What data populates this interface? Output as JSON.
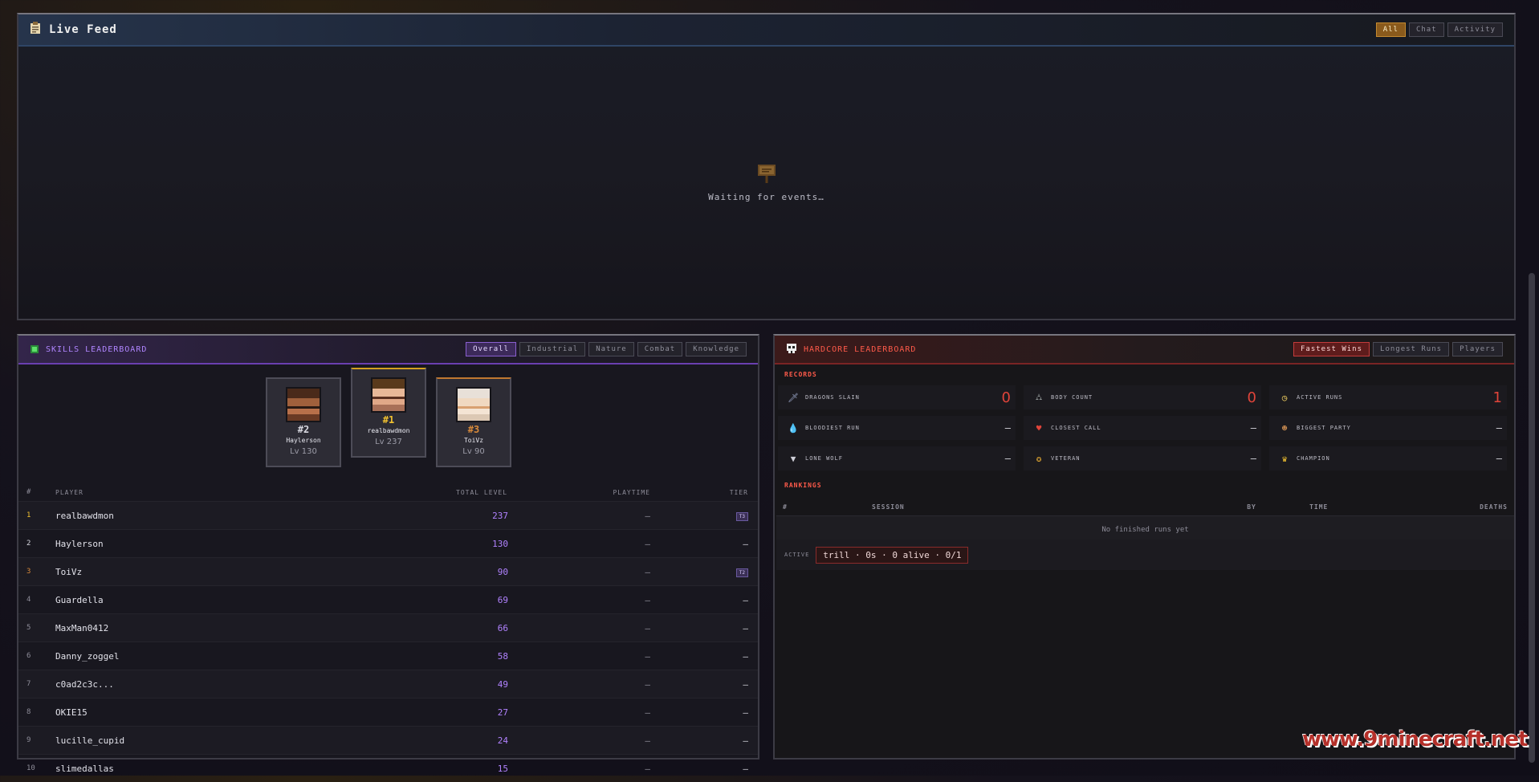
{
  "live_feed": {
    "title": "Live Feed",
    "tabs": [
      "All",
      "Chat",
      "Activity"
    ],
    "active_tab": "All",
    "empty_message": "Waiting for events…"
  },
  "skills": {
    "title": "SKILLS LEADERBOARD",
    "tabs": [
      "Overall",
      "Industrial",
      "Nature",
      "Combat",
      "Knowledge"
    ],
    "active_tab": "Overall",
    "podium": [
      {
        "rank": "#2",
        "name": "Haylerson",
        "level": "Lv 130"
      },
      {
        "rank": "#1",
        "name": "realbawdmon",
        "level": "Lv 237"
      },
      {
        "rank": "#3",
        "name": "ToiVz",
        "level": "Lv 90"
      }
    ],
    "columns": [
      "#",
      "PLAYER",
      "TOTAL LEVEL",
      "PLAYTIME",
      "TIER"
    ],
    "rows": [
      {
        "rank": "1",
        "player": "realbawdmon",
        "total": "237",
        "playtime": "–",
        "tier": "T3"
      },
      {
        "rank": "2",
        "player": "Haylerson",
        "total": "130",
        "playtime": "–",
        "tier": "—"
      },
      {
        "rank": "3",
        "player": "ToiVz",
        "total": "90",
        "playtime": "–",
        "tier": "T2"
      },
      {
        "rank": "4",
        "player": "Guardella",
        "total": "69",
        "playtime": "–",
        "tier": "—"
      },
      {
        "rank": "5",
        "player": "MaxMan0412",
        "total": "66",
        "playtime": "–",
        "tier": "—"
      },
      {
        "rank": "6",
        "player": "Danny_zoggel",
        "total": "58",
        "playtime": "–",
        "tier": "—"
      },
      {
        "rank": "7",
        "player": "c0ad2c3c...",
        "total": "49",
        "playtime": "–",
        "tier": "—"
      },
      {
        "rank": "8",
        "player": "OKIE15",
        "total": "27",
        "playtime": "–",
        "tier": "—"
      },
      {
        "rank": "9",
        "player": "lucille_cupid",
        "total": "24",
        "playtime": "–",
        "tier": "—"
      },
      {
        "rank": "10",
        "player": "slimedallas",
        "total": "15",
        "playtime": "–",
        "tier": "—"
      }
    ]
  },
  "hardcore": {
    "title": "HARDCORE LEADERBOARD",
    "tabs": [
      "Fastest Wins",
      "Longest Runs",
      "Players"
    ],
    "active_tab": "Fastest Wins",
    "records_label": "RECORDS",
    "records": [
      {
        "label": "DRAGONS SLAIN",
        "value": "0",
        "icon": "sword-icon"
      },
      {
        "label": "BODY COUNT",
        "value": "0",
        "icon": "gravestone-icon"
      },
      {
        "label": "ACTIVE RUNS",
        "value": "1",
        "icon": "clock-icon"
      },
      {
        "label": "BLOODIEST RUN",
        "value": "—",
        "icon": "blood-drop-icon"
      },
      {
        "label": "CLOSEST CALL",
        "value": "—",
        "icon": "heart-icon"
      },
      {
        "label": "BIGGEST PARTY",
        "value": "—",
        "icon": "face-icon"
      },
      {
        "label": "LONE WOLF",
        "value": "—",
        "icon": "wolf-icon"
      },
      {
        "label": "VETERAN",
        "value": "—",
        "icon": "medal-icon"
      },
      {
        "label": "CHAMPION",
        "value": "—",
        "icon": "crown-icon"
      }
    ],
    "rankings_label": "RANKINGS",
    "rank_columns": [
      "#",
      "SESSION",
      "BY",
      "TIME",
      "DEATHS"
    ],
    "empty_message": "No finished runs yet",
    "active_label": "ACTIVE",
    "active_run": "trill · 0s · 0 alive · 0/1"
  },
  "watermark": "www.9minecraft.net",
  "colors": {
    "gold": "#8a5a1c",
    "purple": "#b182ff",
    "red": "#e0443a"
  }
}
